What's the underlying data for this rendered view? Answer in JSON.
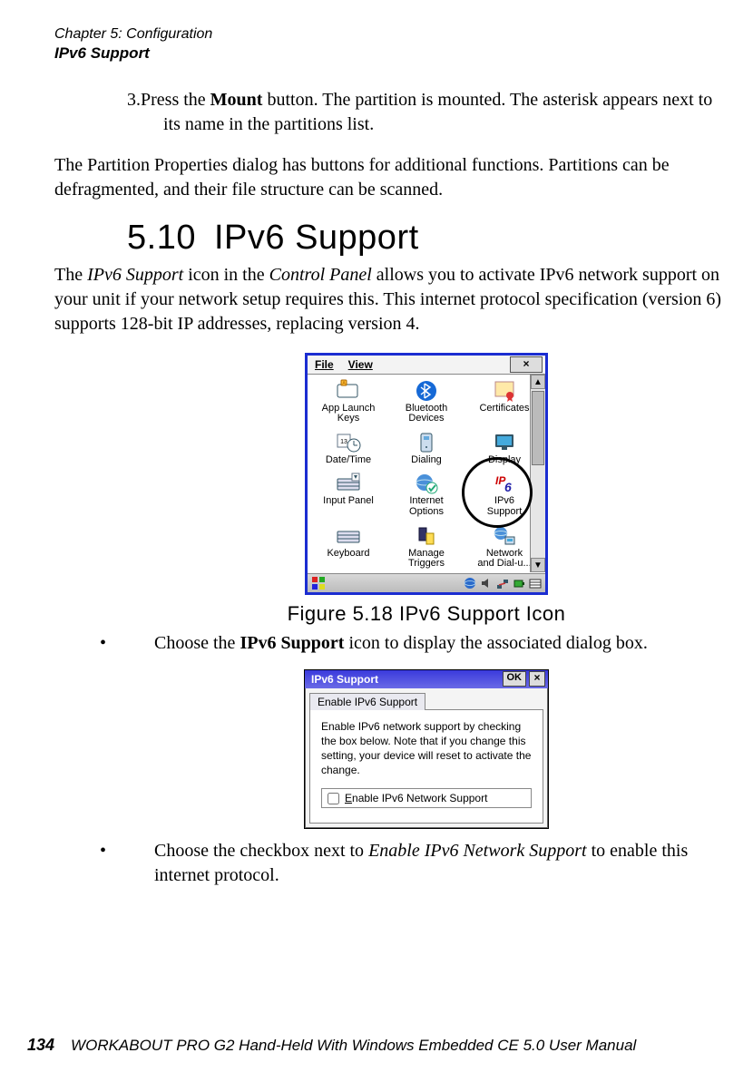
{
  "header": {
    "chapter": "Chapter 5: Configuration",
    "section": "IPv6 Support"
  },
  "step": {
    "num": "3.",
    "pre": "Press the ",
    "bold": "Mount",
    "post": " button. The partition is mounted. The asterisk appears next to its name in the partitions list."
  },
  "para_partition": "The Partition Properties dialog has buttons for additional functions. Partitions can be defragmented, and their file structure can be scanned.",
  "h2": {
    "num": "5.10",
    "title": "IPv6 Support"
  },
  "para_ipv6": {
    "pre": "The ",
    "it1": "IPv6 Support",
    "mid1": " icon in the ",
    "it2": "Control Panel",
    "post": " allows you to activate IPv6 network support on your unit if your network setup requires this. This internet protocol specification (version 6) supports 128-bit IP addresses, replacing version 4."
  },
  "cp": {
    "menu": {
      "file": "File",
      "view": "View",
      "close": "×"
    },
    "items": [
      {
        "label": "App Launch\nKeys",
        "icon": "keys"
      },
      {
        "label": "Bluetooth\nDevices",
        "icon": "bluetooth"
      },
      {
        "label": "Certificates",
        "icon": "certificate"
      },
      {
        "label": "Date/Time",
        "icon": "clock"
      },
      {
        "label": "Dialing",
        "icon": "phone"
      },
      {
        "label": "Display",
        "icon": "display"
      },
      {
        "label": "Input Panel",
        "icon": "keyboard"
      },
      {
        "label": "Internet\nOptions",
        "icon": "globe-check"
      },
      {
        "label": "IPv6\nSupport",
        "icon": "ipv6"
      },
      {
        "label": "Keyboard",
        "icon": "keyboard2"
      },
      {
        "label": "Manage\nTriggers",
        "icon": "triggers"
      },
      {
        "label": "Network\nand Dial-u...",
        "icon": "network"
      }
    ],
    "scrollbar": {
      "up": "▲",
      "down": "▼"
    }
  },
  "caption": "Figure 5.18 IPv6 Support Icon",
  "bullet1": {
    "dot": "•",
    "pre": "Choose the ",
    "bold": "IPv6 Support",
    "post": " icon to display the associated dialog box."
  },
  "dialog": {
    "title": "IPv6 Support",
    "ok": "OK",
    "close": "×",
    "tab": "Enable IPv6 Support",
    "explain": "Enable IPv6 network support by checking the box below.  Note that if you change this setting, your device will reset to activate the change.",
    "checkbox_label": "Enable IPv6 Network Support"
  },
  "bullet2": {
    "dot": "•",
    "pre": "Choose the checkbox next to ",
    "it": "Enable IPv6 Network Support",
    "post": " to enable this internet protocol."
  },
  "footer": {
    "page": "134",
    "manual": "WORKABOUT PRO G2 Hand-Held With Windows Embedded CE 5.0 User Manual"
  }
}
